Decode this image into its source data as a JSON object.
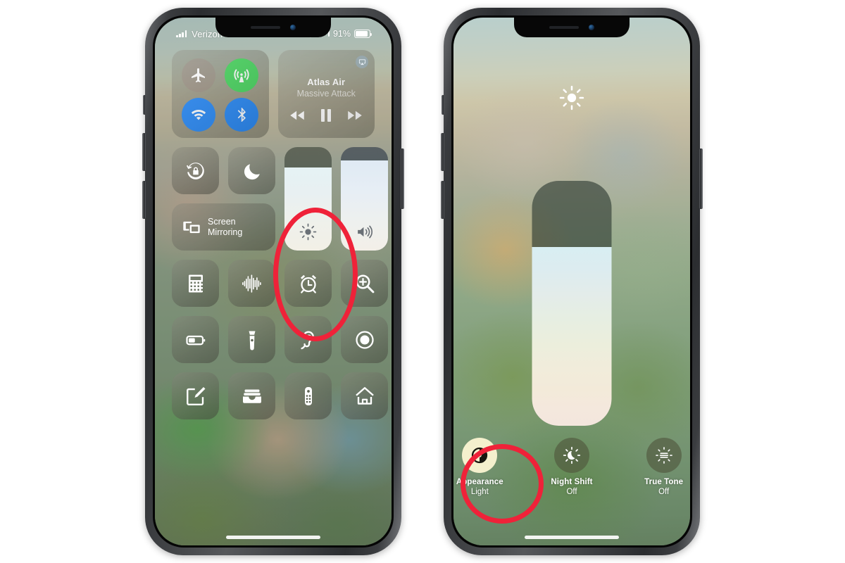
{
  "meta": {
    "title": "iPhone Control Center — Brightness and Appearance (Dark Mode) toggles",
    "accent_red": "#ef2239",
    "toggle_green": "#4cd662",
    "toggle_blue": "#2d8cf7",
    "appearance_active_bg": "#f4f0cd"
  },
  "phone_left": {
    "status_bar": {
      "carrier": "Verizon",
      "signal_icon": "cellular-bars-icon",
      "wifi_icon": "wifi-icon",
      "location_icon": "location-arrow-icon",
      "headphones_icon": "headphones-icon",
      "alarm_icon": "alarm-small-icon",
      "battery_percent": "91%",
      "battery_level": 91,
      "battery_icon": "battery-icon"
    },
    "connectivity": {
      "airplane": {
        "label": "Airplane Mode",
        "icon": "airplane-icon",
        "state": "off"
      },
      "cellular": {
        "label": "Cellular Data",
        "icon": "cellular-antenna-icon",
        "state": "on"
      },
      "wifi": {
        "label": "Wi-Fi",
        "icon": "wifi-icon",
        "state": "on"
      },
      "bluetooth": {
        "label": "Bluetooth",
        "icon": "bluetooth-icon",
        "state": "on"
      }
    },
    "now_playing": {
      "track": "Atlas Air",
      "artist": "Massive Attack",
      "airplay_icon": "airplay-icon",
      "rewind_icon": "rewind-icon",
      "pause_icon": "pause-icon",
      "forward_icon": "fast-forward-icon"
    },
    "utilities": {
      "rotation_lock": {
        "label": "Rotation Lock",
        "icon": "rotation-lock-icon"
      },
      "do_not_disturb": {
        "label": "Do Not Disturb",
        "icon": "moon-icon"
      },
      "screen_mirroring": {
        "label": "Screen\nMirroring",
        "label_line1": "Screen",
        "label_line2": "Mirroring",
        "icon": "screen-mirroring-icon"
      }
    },
    "sliders": {
      "brightness": {
        "label": "Brightness",
        "icon": "brightness-sun-icon",
        "value": 80
      },
      "volume": {
        "label": "Volume",
        "icon": "volume-speaker-icon",
        "value": 87
      }
    },
    "shortcuts": [
      {
        "label": "Calculator",
        "icon": "calculator-icon"
      },
      {
        "label": "Voice Memos",
        "icon": "voice-memos-waveform-icon"
      },
      {
        "label": "Timer",
        "icon": "alarm-clock-icon"
      },
      {
        "label": "Magnifier",
        "icon": "magnifier-icon"
      },
      {
        "label": "Low Power Mode",
        "icon": "low-power-battery-icon"
      },
      {
        "label": "Flashlight",
        "icon": "flashlight-icon"
      },
      {
        "label": "Hearing",
        "icon": "hearing-ear-icon"
      },
      {
        "label": "Screen Recording",
        "icon": "screen-record-icon"
      },
      {
        "label": "Notes",
        "icon": "notes-compose-icon"
      },
      {
        "label": "Wallet",
        "icon": "wallet-icon"
      },
      {
        "label": "Apple TV Remote",
        "icon": "remote-icon"
      },
      {
        "label": "Home",
        "icon": "home-house-icon"
      }
    ],
    "home_indicator": "home-indicator-bar",
    "annotation": {
      "shape": "ellipse",
      "target": "brightness-slider",
      "color": "#ef2239"
    }
  },
  "phone_right": {
    "header_icon": "brightness-sun-icon",
    "brightness_slider": {
      "label": "Brightness",
      "value": 73
    },
    "toggles": [
      {
        "name": "Appearance",
        "state": "Light",
        "icon": "appearance-contrast-icon",
        "active": true
      },
      {
        "name": "Night Shift",
        "state": "Off",
        "icon": "night-shift-icon",
        "active": false
      },
      {
        "name": "True Tone",
        "state": "Off",
        "icon": "true-tone-icon",
        "active": false
      }
    ],
    "home_indicator": "home-indicator-bar",
    "annotation": {
      "shape": "ellipse",
      "target": "appearance-toggle",
      "color": "#ef2239"
    }
  }
}
